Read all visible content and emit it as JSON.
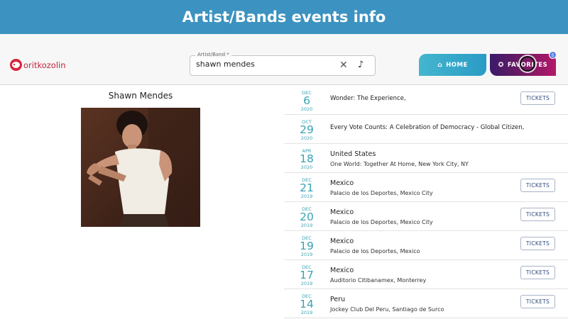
{
  "header": {
    "title": "Artist/Bands events info"
  },
  "logo": {
    "text": "oritkozolin",
    "color": "#d7263d"
  },
  "search": {
    "label": "Artist/Band *",
    "value": "shawn mendes"
  },
  "nav": {
    "home_label": "HOME",
    "favorites_label": "FAVORITES",
    "favorites_count": "5"
  },
  "artist": {
    "name": "Shawn Mendes"
  },
  "events": [
    {
      "month": "DEC",
      "day": "6",
      "year": "2020",
      "title": "Wonder: The Experience,",
      "country": "",
      "venue": "",
      "ticket": "TICKETS"
    },
    {
      "month": "OCT",
      "day": "29",
      "year": "2020",
      "title": "Every Vote Counts: A Celebration of Democracy - Global Citizen,",
      "country": "",
      "venue": "",
      "ticket": ""
    },
    {
      "month": "APR",
      "day": "18",
      "year": "2020",
      "title": "",
      "country": "United States",
      "venue": "One World: Together At Home, New York City, NY",
      "ticket": ""
    },
    {
      "month": "DEC",
      "day": "21",
      "year": "2019",
      "title": "",
      "country": "Mexico",
      "venue": "Palacio de los Deportes, Mexico City",
      "ticket": "TICKETS"
    },
    {
      "month": "DEC",
      "day": "20",
      "year": "2019",
      "title": "",
      "country": "Mexico",
      "venue": "Palacio de los Deportes, Mexico City",
      "ticket": "TICKETS"
    },
    {
      "month": "DEC",
      "day": "19",
      "year": "2019",
      "title": "",
      "country": "Mexico",
      "venue": "Palacio de los Deportes, Mexico",
      "ticket": "TICKETS"
    },
    {
      "month": "DEC",
      "day": "17",
      "year": "2019",
      "title": "",
      "country": "Mexico",
      "venue": "Auditorio Citibanamex, Monterrey",
      "ticket": "TICKETS"
    },
    {
      "month": "DEC",
      "day": "14",
      "year": "2019",
      "title": "",
      "country": "Peru",
      "venue": "Jockey Club Del Peru, Santiago de Surco",
      "ticket": "TICKETS"
    }
  ],
  "colors": {
    "banner": "#3c92c0",
    "date_accent": "#3aa3b3"
  },
  "icons": {
    "home": "home-icon",
    "favorites": "star-icon",
    "clear": "close-icon",
    "voice": "music-note-icon"
  }
}
